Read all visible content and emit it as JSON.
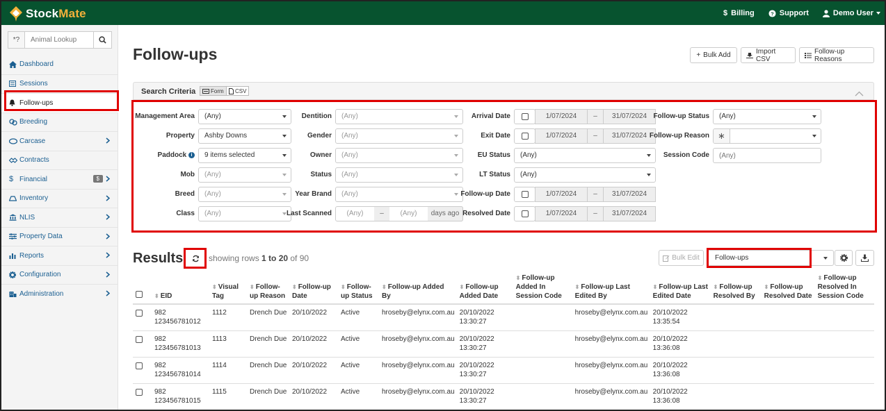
{
  "app": {
    "brand_a": "Stock",
    "brand_b": "Mate"
  },
  "topnav": {
    "billing": "Billing",
    "support": "Support",
    "user": "Demo User"
  },
  "sidebar": {
    "lookup_prefix": "*?",
    "lookup_placeholder": "Animal Lookup",
    "items": [
      {
        "label": "Dashboard"
      },
      {
        "label": "Sessions"
      },
      {
        "label": "Follow-ups"
      },
      {
        "label": "Breeding"
      },
      {
        "label": "Carcase"
      },
      {
        "label": "Contracts"
      },
      {
        "label": "Financial",
        "badge": "$"
      },
      {
        "label": "Inventory"
      },
      {
        "label": "NLIS"
      },
      {
        "label": "Property Data"
      },
      {
        "label": "Reports"
      },
      {
        "label": "Configuration"
      },
      {
        "label": "Administration"
      }
    ]
  },
  "page": {
    "title": "Follow-ups",
    "bulk_add": "Bulk Add",
    "import_csv": "Import CSV",
    "reasons": "Follow-up Reasons"
  },
  "search": {
    "title": "Search Criteria",
    "form_tab": "Form",
    "csv_tab": "CSV",
    "fields": {
      "management_area": {
        "label": "Management Area",
        "value": "(Any)"
      },
      "property": {
        "label": "Property",
        "value": "Ashby Downs"
      },
      "paddock": {
        "label": "Paddock",
        "value": "9 items selected"
      },
      "mob": {
        "label": "Mob",
        "value": "(Any)"
      },
      "breed": {
        "label": "Breed",
        "value": "(Any)"
      },
      "class": {
        "label": "Class",
        "value": "(Any)"
      },
      "dentition": {
        "label": "Dentition",
        "value": "(Any)"
      },
      "gender": {
        "label": "Gender",
        "value": "(Any)"
      },
      "owner": {
        "label": "Owner",
        "value": "(Any)"
      },
      "status": {
        "label": "Status",
        "value": "(Any)"
      },
      "year_brand": {
        "label": "Year Brand",
        "value": "(Any)"
      },
      "last_scanned": {
        "label": "Last Scanned",
        "from": "(Any)",
        "to": "(Any)",
        "suffix": "days ago"
      },
      "arrival_date": {
        "label": "Arrival Date",
        "from": "1/07/2024",
        "to": "31/07/2024"
      },
      "exit_date": {
        "label": "Exit Date",
        "from": "1/07/2024",
        "to": "31/07/2024"
      },
      "eu_status": {
        "label": "EU Status",
        "value": "(Any)"
      },
      "lt_status": {
        "label": "LT Status",
        "value": "(Any)"
      },
      "follow_up_date": {
        "label": "Follow-up Date",
        "from": "1/07/2024",
        "to": "31/07/2024"
      },
      "resolved_date": {
        "label": "Resolved Date",
        "from": "1/07/2024",
        "to": "31/07/2024"
      },
      "follow_up_status": {
        "label": "Follow-up Status",
        "value": "(Any)"
      },
      "follow_up_reason": {
        "label": "Follow-up Reason",
        "value": ""
      },
      "session_code": {
        "label": "Session Code",
        "placeholder": "(Any)"
      }
    },
    "range_sep": "–"
  },
  "results": {
    "title": "Results",
    "showing_prefix": "showing rows ",
    "range": "1 to 20",
    "of": " of 90",
    "bulk_edit": "Bulk Edit",
    "view_select": "Follow-ups",
    "columns": [
      "EID",
      "Visual Tag",
      "Follow-up Reason",
      "Follow-up Date",
      "Follow-up Status",
      "Follow-up Added By",
      "Follow-up Added Date",
      "Follow-up Added In Session Code",
      "Follow-up Last Edited By",
      "Follow-up Last Edited Date",
      "Follow-up Resolved By",
      "Follow-up Resolved Date",
      "Follow-up Resolved In Session Code"
    ],
    "rows": [
      {
        "eid1": "982",
        "eid2": "123456781012",
        "tag": "1112",
        "reason": "Drench Due",
        "date": "20/10/2022",
        "status": "Active",
        "added_by": "hroseby@elynx.com.au",
        "added_date1": "20/10/2022",
        "added_date2": "13:30:27",
        "added_session": "",
        "edited_by": "hroseby@elynx.com.au",
        "edited_date1": "20/10/2022",
        "edited_date2": "13:35:54",
        "resolved_by": "",
        "resolved_date": "",
        "resolved_session": ""
      },
      {
        "eid1": "982",
        "eid2": "123456781013",
        "tag": "1113",
        "reason": "Drench Due",
        "date": "20/10/2022",
        "status": "Active",
        "added_by": "hroseby@elynx.com.au",
        "added_date1": "20/10/2022",
        "added_date2": "13:30:27",
        "added_session": "",
        "edited_by": "hroseby@elynx.com.au",
        "edited_date1": "20/10/2022",
        "edited_date2": "13:36:08",
        "resolved_by": "",
        "resolved_date": "",
        "resolved_session": ""
      },
      {
        "eid1": "982",
        "eid2": "123456781014",
        "tag": "1114",
        "reason": "Drench Due",
        "date": "20/10/2022",
        "status": "Active",
        "added_by": "hroseby@elynx.com.au",
        "added_date1": "20/10/2022",
        "added_date2": "13:30:27",
        "added_session": "",
        "edited_by": "hroseby@elynx.com.au",
        "edited_date1": "20/10/2022",
        "edited_date2": "13:36:08",
        "resolved_by": "",
        "resolved_date": "",
        "resolved_session": ""
      },
      {
        "eid1": "982",
        "eid2": "123456781015",
        "tag": "1115",
        "reason": "Drench Due",
        "date": "20/10/2022",
        "status": "Active",
        "added_by": "hroseby@elynx.com.au",
        "added_date1": "20/10/2022",
        "added_date2": "13:30:27",
        "added_session": "",
        "edited_by": "hroseby@elynx.com.au",
        "edited_date1": "20/10/2022",
        "edited_date2": "13:36:08",
        "resolved_by": "",
        "resolved_date": "",
        "resolved_session": ""
      }
    ]
  },
  "colors": {
    "brand_green": "#07532f",
    "brand_orange": "#f3b13a",
    "highlight_red": "#e00000",
    "link_blue": "#1b5f91"
  },
  "icons": [
    "logo-icon",
    "dollar-icon",
    "help-icon",
    "user-icon",
    "search-icon",
    "home-icon",
    "list-icon",
    "bell-icon",
    "breeding-icon",
    "carcase-icon",
    "contracts-icon",
    "financial-icon",
    "inventory-icon",
    "nls-icon",
    "property-data-icon",
    "reports-icon",
    "configuration-icon",
    "administration-icon",
    "plus-icon",
    "import-icon",
    "refresh-icon",
    "edit-icon",
    "gear-icon",
    "download-icon",
    "info-icon",
    "asterisk-icon",
    "chevron-up-icon",
    "chevron-right-icon",
    "sort-icon"
  ]
}
